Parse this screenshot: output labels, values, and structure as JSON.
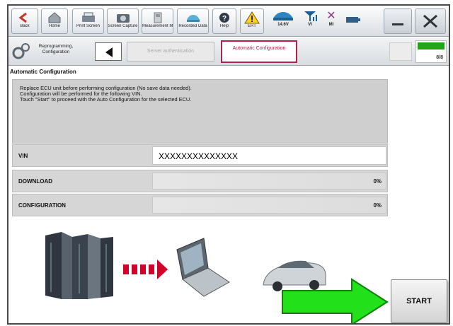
{
  "toolbar": {
    "back_label": "Back",
    "home_label": "Home",
    "print_label": "Print Screen",
    "capture_label": "Screen Capture",
    "measurement_label": "Measurement Mode",
    "recorded_label": "Recorded Data",
    "help_label": "Help",
    "warning_label": "ERT",
    "voltage_label": "14.6V",
    "vi_label": "VI",
    "mi_label": "MI"
  },
  "navbar": {
    "reprog_label": "Reprogramming, Configuration",
    "server_label": "Server authentication",
    "auto_label": "Automatic Configuration",
    "page_counter": "8/8"
  },
  "section": {
    "title": "Automatic Configuration"
  },
  "message": "Replace ECU unit before performing configuration (No save data needed).\nConfiguration will be performed for the following VIN.\nTouch \"Start\" to proceed with the Auto Configuration for the selected ECU.",
  "rows": [
    {
      "label": "VIN",
      "value": "XXXXXXXXXXXXXX"
    },
    {
      "label": "DOWNLOAD",
      "percent": "0%",
      "progress": 0
    },
    {
      "label": "CONFIGURATION",
      "percent": "0%",
      "progress": 0
    }
  ],
  "start_button": "START",
  "colors": {
    "accent": "#b0214f",
    "arrow": "#22e01a",
    "progress_green": "#1fa51a",
    "flow_arrow": "#d1002a"
  }
}
